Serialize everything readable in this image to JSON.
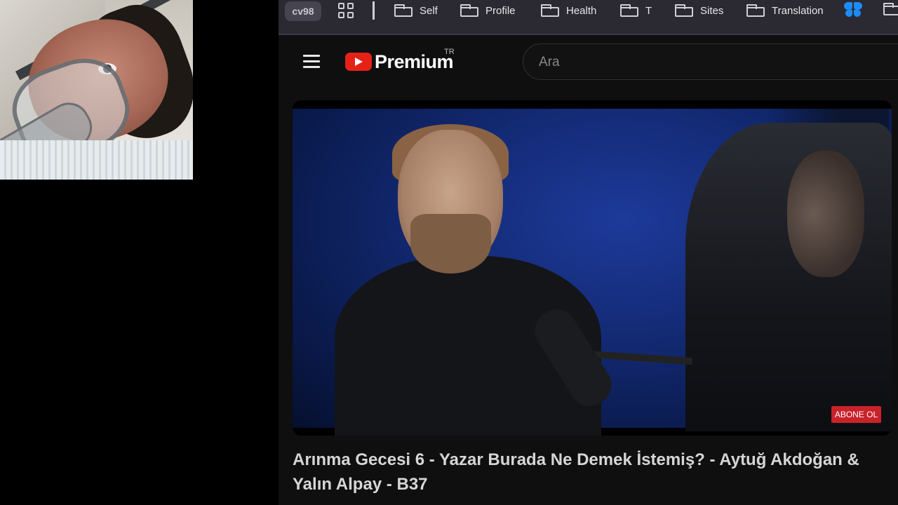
{
  "bookmarks": {
    "profile_label": "cv98",
    "folders": [
      "Self",
      "Profile",
      "Health",
      "T",
      "Sites",
      "Translation"
    ]
  },
  "youtube": {
    "logo_text": "Premium",
    "region_code": "TR",
    "search_placeholder": "Ara"
  },
  "video": {
    "overlay_button": "ABONE OL",
    "title": "Arınma Gecesi 6 - Yazar Burada Ne Demek İstemiş? - Aytuğ Akdoğan & Yalın Alpay - B37"
  },
  "colors": {
    "youtube_red": "#e62117",
    "bluesky_blue": "#1d8cf8",
    "subscribe_red": "#c8222a"
  },
  "icons": [
    "apps-grid-icon",
    "folder-icon",
    "bluesky-butterfly-icon",
    "hamburger-menu-icon",
    "youtube-play-icon"
  ]
}
